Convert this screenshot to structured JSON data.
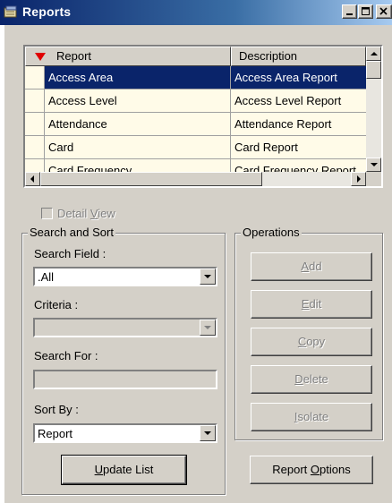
{
  "window": {
    "title": "Reports",
    "icon": "reports-book-icon"
  },
  "list": {
    "columns": [
      "Report",
      "Description"
    ],
    "rows": [
      {
        "report": "Access Area",
        "description": "Access Area Report",
        "selected": true
      },
      {
        "report": "Access Level",
        "description": "Access Level Report",
        "selected": false
      },
      {
        "report": "Attendance",
        "description": "Attendance Report",
        "selected": false
      },
      {
        "report": "Card",
        "description": "Card Report",
        "selected": false
      },
      {
        "report": "Card Frequency",
        "description": "Card Frequency Report",
        "selected": false
      }
    ]
  },
  "detail_view": {
    "label_pre": "Detail ",
    "label_accel": "V",
    "label_post": "iew",
    "checked": false,
    "enabled": false
  },
  "search": {
    "group_label": "Search and Sort",
    "field_label": "Search Field :",
    "field_value": ".All",
    "criteria_label": "Criteria :",
    "criteria_value": "",
    "search_for_label": "Search For :",
    "search_for_value": "",
    "sort_by_label": "Sort By :",
    "sort_by_value": "Report"
  },
  "operations": {
    "group_label": "Operations",
    "buttons": [
      {
        "accel": "A",
        "rest": "dd"
      },
      {
        "accel": "E",
        "rest": "dit"
      },
      {
        "accel": "C",
        "rest": "opy"
      },
      {
        "accel": "D",
        "rest": "elete"
      },
      {
        "accel": "I",
        "rest": "solate"
      }
    ]
  },
  "update_button": {
    "accel": "U",
    "rest": "pdate List"
  },
  "report_options_button": {
    "pre": "Report ",
    "accel": "O",
    "rest": "ptions"
  },
  "colors": {
    "selection": "#0a246a",
    "row_bg": "#fffbe8",
    "sort_arrow": "#e00000",
    "face": "#d4d0c8"
  }
}
